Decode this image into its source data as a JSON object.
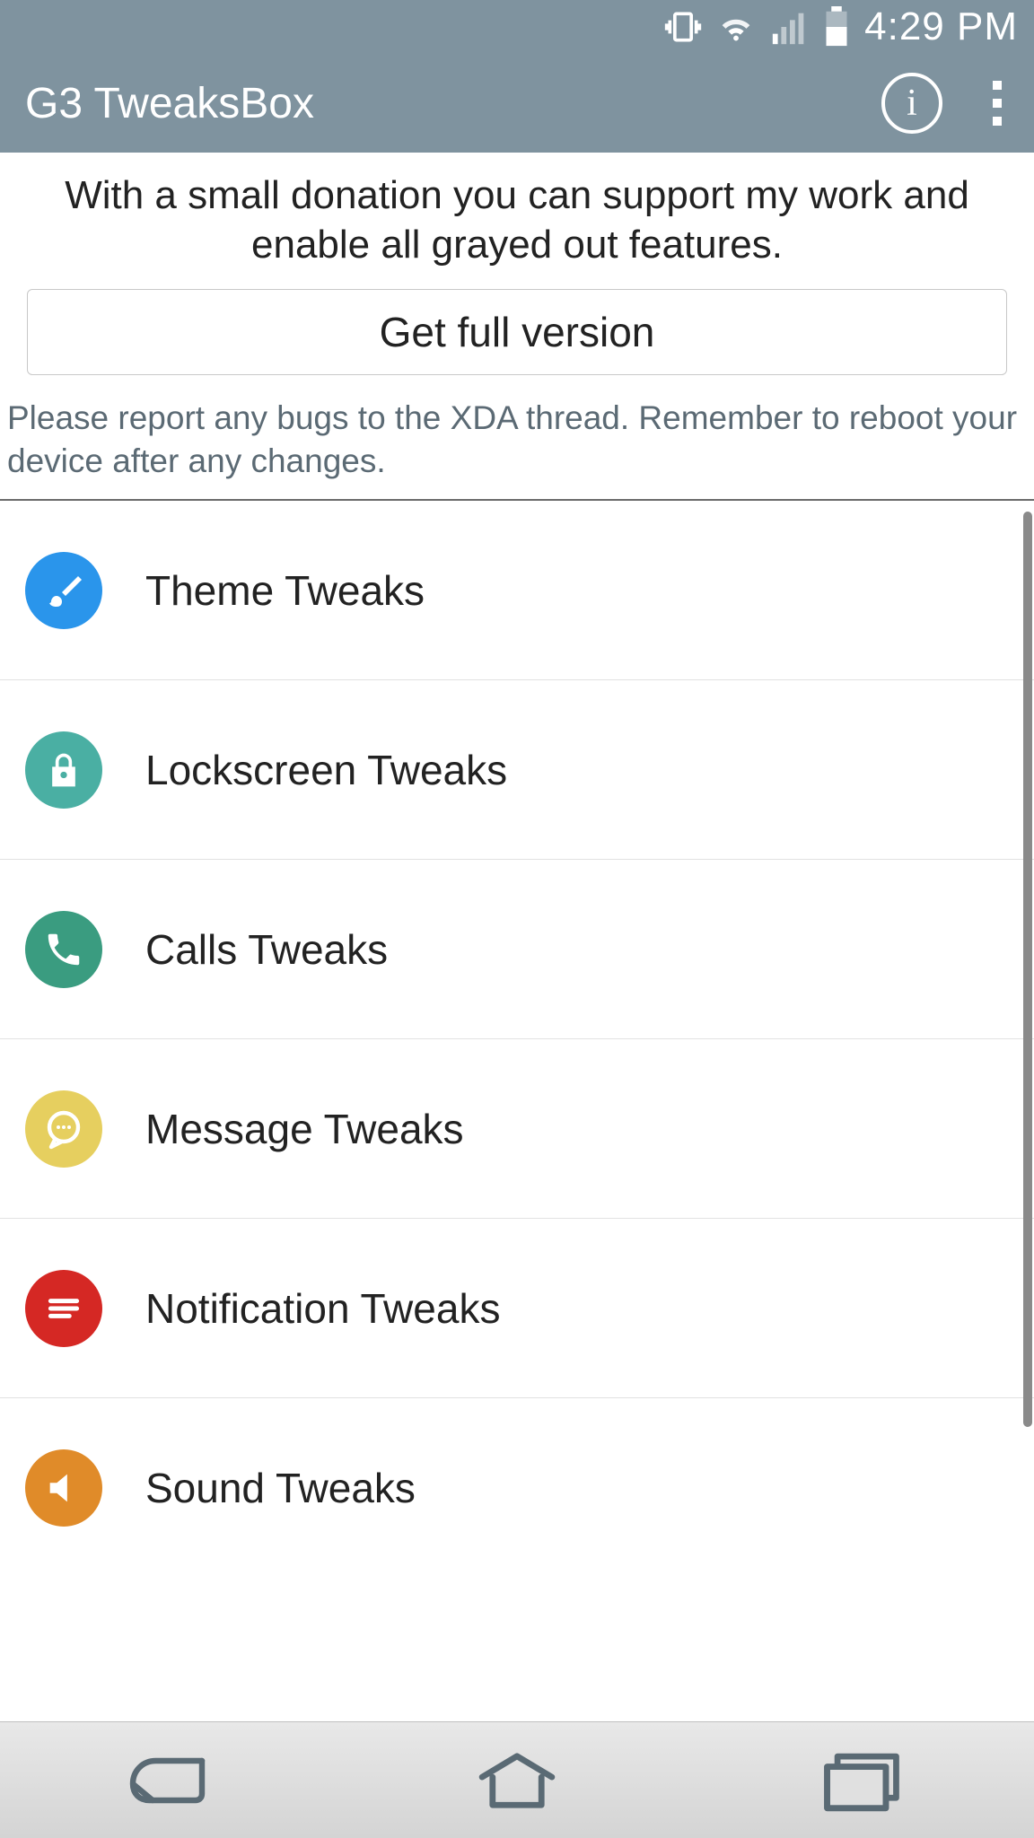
{
  "statusbar": {
    "time": "4:29 PM"
  },
  "appbar": {
    "title": "G3 TweaksBox"
  },
  "donation": {
    "text": "With a small donation you can support my work and enable all grayed out features.",
    "button": "Get full version"
  },
  "report_text": "Please report any bugs to the XDA thread. Remember to reboot your device after any changes.",
  "items": [
    {
      "label": "Theme Tweaks",
      "icon": "brush-icon",
      "color": "c-blue"
    },
    {
      "label": "Lockscreen Tweaks",
      "icon": "lock-icon",
      "color": "c-teal"
    },
    {
      "label": "Calls Tweaks",
      "icon": "phone-icon",
      "color": "c-green"
    },
    {
      "label": "Message Tweaks",
      "icon": "chat-icon",
      "color": "c-yellow"
    },
    {
      "label": "Notification Tweaks",
      "icon": "notification-icon",
      "color": "c-red"
    },
    {
      "label": "Sound Tweaks",
      "icon": "speaker-icon",
      "color": "c-orange"
    }
  ]
}
